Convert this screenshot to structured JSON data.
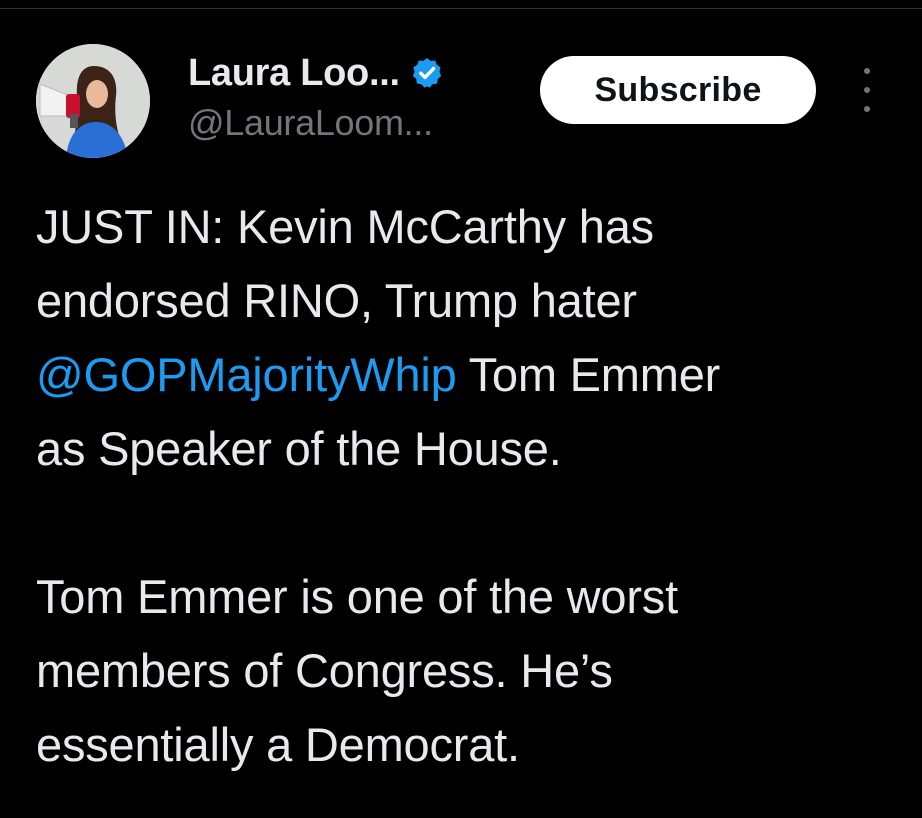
{
  "author": {
    "display_name": "Laura Loo...",
    "handle": "@LauraLoom...",
    "verified_badge_color": "#1d9bf0",
    "avatar_icon": "profile-photo-megaphone"
  },
  "actions": {
    "subscribe_label": "Subscribe",
    "more_icon": "more-vertical-icon"
  },
  "tweet": {
    "paragraph1": {
      "line1": "JUST IN: Kevin McCarthy has",
      "line2": "endorsed RINO, Trump hater",
      "mention": "@GOPMajorityWhip",
      "line3_rest": " Tom Emmer",
      "line4": "as Speaker of the House."
    },
    "paragraph2": {
      "line1": "Tom Emmer is one of the worst",
      "line2": "members of Congress. He’s",
      "line3": "essentially a Democrat."
    }
  },
  "colors": {
    "background": "#000000",
    "text": "#e7e9ea",
    "secondary_text": "#71767b",
    "link": "#1d9bf0"
  }
}
